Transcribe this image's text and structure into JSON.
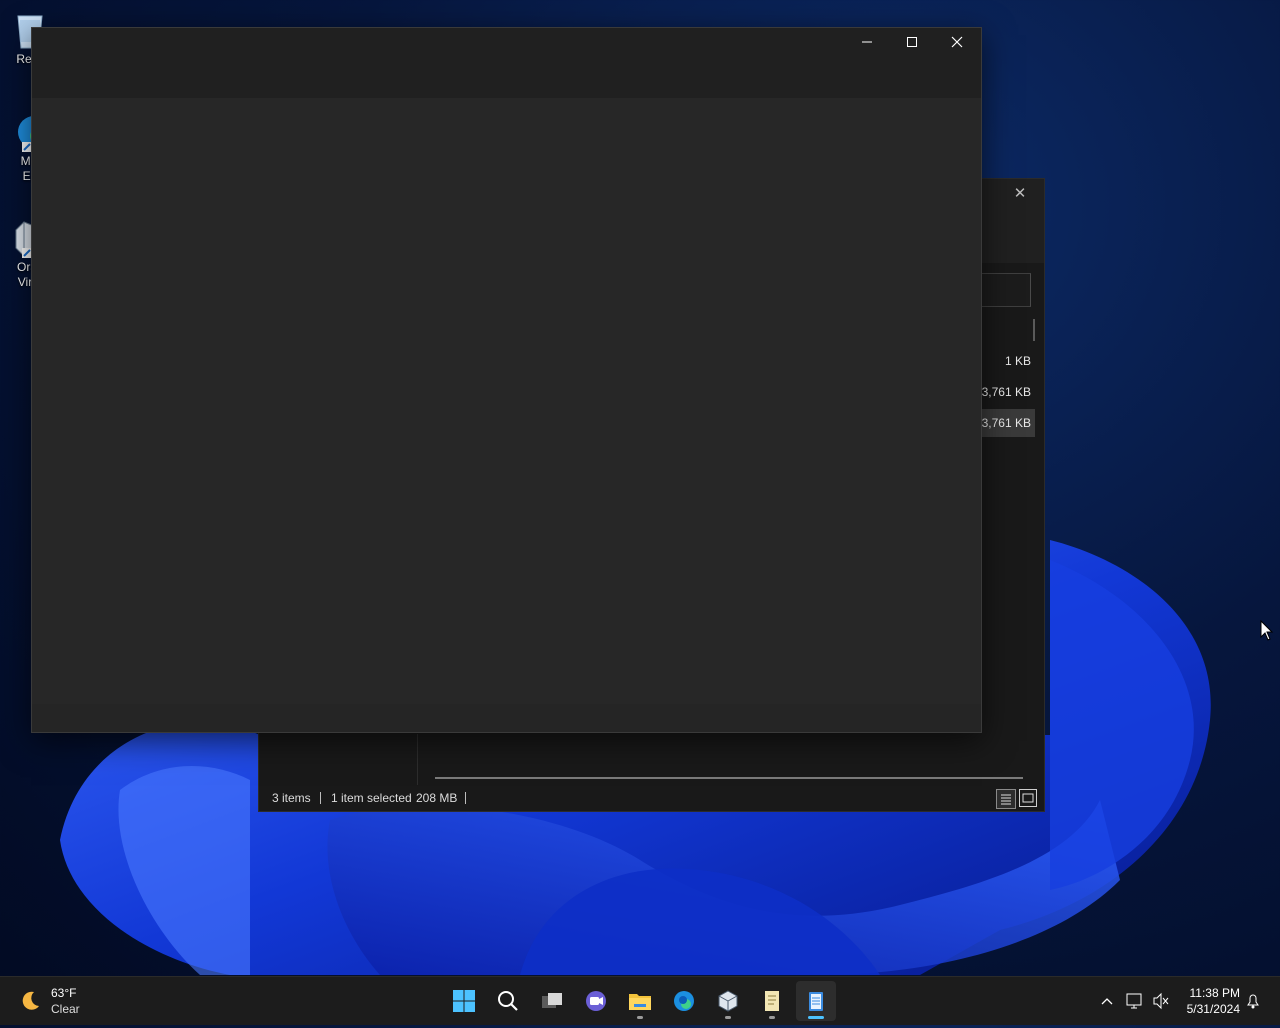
{
  "desktop": {
    "icons": [
      {
        "label": "Recy",
        "icon": "recycle-bin-icon"
      },
      {
        "label": "Mic\nEd",
        "icon": "edge-icon"
      },
      {
        "label": "Orac\nVirtu",
        "icon": "virtualbox-icon"
      }
    ]
  },
  "front_window": {
    "controls": {
      "minimize": "—",
      "maximize": "☐",
      "close": "✕"
    }
  },
  "explorer": {
    "close_glyph": "✕",
    "file_sizes": [
      "1 KB",
      "3,761 KB",
      "3,761 KB"
    ],
    "selected_index": 2,
    "status": {
      "items": "3 items",
      "selected": "1 item selected",
      "size": "208 MB"
    }
  },
  "taskbar": {
    "weather": {
      "temp": "63°F",
      "condition": "Clear",
      "icon": "moon-icon"
    },
    "apps": [
      {
        "name": "start",
        "icon": "windows-logo-icon"
      },
      {
        "name": "search",
        "icon": "search-icon"
      },
      {
        "name": "task-view",
        "icon": "task-view-icon"
      },
      {
        "name": "chat",
        "icon": "teams-chat-icon"
      },
      {
        "name": "file-explorer",
        "icon": "folder-icon"
      },
      {
        "name": "edge",
        "icon": "edge-icon"
      },
      {
        "name": "virtualbox",
        "icon": "virtualbox-icon"
      },
      {
        "name": "notepad-doc",
        "icon": "document-icon"
      },
      {
        "name": "notepad",
        "icon": "notepad-icon"
      }
    ],
    "clock": {
      "time": "11:38 PM",
      "date": "5/31/2024"
    }
  },
  "colors": {
    "accent": "#4cc2ff",
    "window_bg": "#202020",
    "content_bg": "#272727",
    "taskbar_bg": "#1c1c1c"
  }
}
